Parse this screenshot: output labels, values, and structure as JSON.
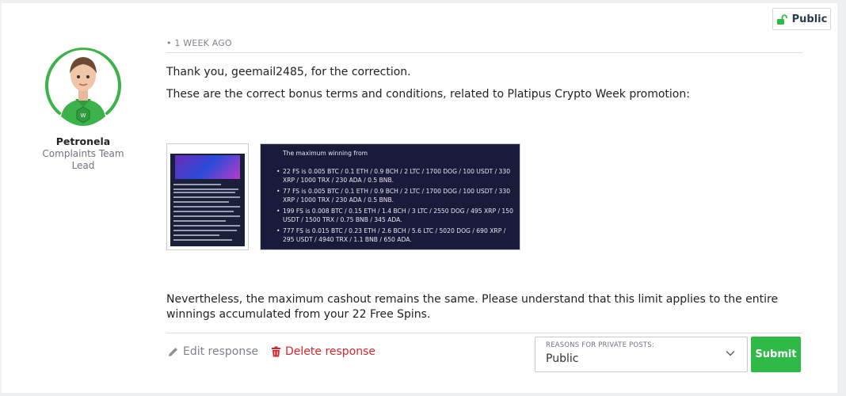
{
  "visibility_badge": {
    "label": "Public",
    "icon": "unlock-icon"
  },
  "author": {
    "name": "Petronela",
    "role": "Complaints Team Lead",
    "accent_color": "#3bb34a"
  },
  "post": {
    "timestamp": "• 1 WEEK AGO",
    "paragraph_1": "Thank you, geemail2485, for the correction.",
    "paragraph_2": "These are the correct bonus terms and conditions, related to Platipus Crypto Week promotion:",
    "paragraph_3": "Nevertheless, the maximum cashout remains the same. Please understand that this limit applies to the entire winnings accumulated from your 22 Free Spins."
  },
  "attachment_2": {
    "lead": "The maximum winning from",
    "items": [
      "22 FS is 0.005 BTC / 0.1 ETH / 0.9 BCH / 2 LTC / 1700 DOG / 100 USDT / 330 XRP / 1000 TRX / 230 ADA / 0.5 BNB.",
      "77 FS is 0.005 BTC / 0.1 ETH / 0.9 BCH / 2 LTC / 1700 DOG / 100 USDT / 330 XRP / 1000 TRX / 230 ADA / 0.5 BNB.",
      "199 FS is 0.008 BTC / 0.15 ETH / 1.4 BCH / 3 LTC / 2550 DOG / 495 XRP / 150 USDT / 1500 TRX / 0.75 BNB / 345 ADA.",
      "777 FS is 0.015 BTC / 0.23 ETH / 2.6 BCH / 5.6 LTC / 5020 DOG / 690 XRP / 295 USDT / 4940 TRX / 1.1 BNB / 650 ADA."
    ]
  },
  "actions": {
    "edit_label": "Edit response",
    "delete_label": "Delete response",
    "edit_icon": "pencil-icon",
    "delete_icon": "trash-icon"
  },
  "privacy_select": {
    "label": "REASONS FOR PRIVATE POSTS:",
    "value": "Public"
  },
  "submit_label": "Submit",
  "colors": {
    "submit": "#2fba47",
    "delete": "#d9252b",
    "badge_icon": "#2fba47"
  }
}
